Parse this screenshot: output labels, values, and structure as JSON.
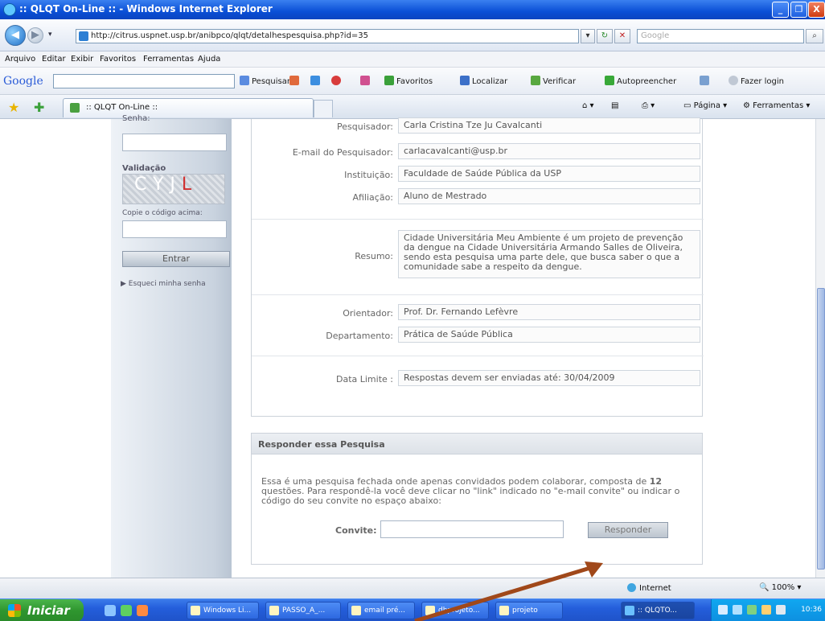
{
  "window": {
    "title": ":: QLQT On-Line :: - Windows Internet Explorer",
    "min_label": "_",
    "max_label": "❐",
    "close_label": "X"
  },
  "address": {
    "url": "http://citrus.uspnet.usp.br/anibpco/qlqt/detalhespesquisa.php?id=35",
    "go_label": "✕",
    "search_placeholder": "Google"
  },
  "menu": [
    "Arquivo",
    "Editar",
    "Exibir",
    "Favoritos",
    "Ferramentas",
    "Ajuda"
  ],
  "google_toolbar": {
    "logo": "Google",
    "items": [
      "Pesquisar",
      "Favoritos",
      "Localizar",
      "Verificar",
      "Autopreencher",
      "Fazer login"
    ]
  },
  "tabs": {
    "active_tab": ":: QLQT On-Line ::",
    "commands": [
      "Página",
      "Ferramentas"
    ]
  },
  "sidebar": {
    "senha_label": "Senha:",
    "validacao_label": "Validação",
    "captcha_text": "CYJL",
    "copy_code_label": "Copie o código acima:",
    "entrar_label": "Entrar",
    "forgot_label": "Esqueci minha senha"
  },
  "details": [
    {
      "key": "Pesquisador:",
      "value": "Carla Cristina Tze Ju Cavalcanti"
    },
    {
      "key": "E-mail do Pesquisador:",
      "value": "carlacavalcanti@usp.br"
    },
    {
      "key": "Instituição:",
      "value": "Faculdade de Saúde Pública da USP"
    },
    {
      "key": "Afiliação:",
      "value": "Aluno de Mestrado"
    },
    {
      "key": "Resumo:",
      "value": "Cidade Universitária Meu Ambiente é um projeto de prevenção da dengue na Cidade Universitária Armando Salles de Oliveira, sendo esta pesquisa uma parte dele, que busca saber o que a comunidade sabe a respeito da dengue."
    },
    {
      "key": "Orientador:",
      "value": "Prof. Dr. Fernando Lefèvre"
    },
    {
      "key": "Departamento:",
      "value": "Prática de Saúde Pública"
    },
    {
      "key": "Data Limite :",
      "value": "Respostas devem ser enviadas até: 30/04/2009"
    }
  ],
  "respond": {
    "title": "Responder essa Pesquisa",
    "text_1": "Essa é uma pesquisa fechada onde apenas convidados podem colaborar, composta de",
    "count": "12",
    "text_2": "questões. Para respondê-la você deve clicar no \"link\" indicado no \"e-mail convite\" ou indicar o código do seu convite no espaço abaixo:",
    "convite_label": "Convite:",
    "button_label": "Responder"
  },
  "status": {
    "zone": "Internet",
    "zoom": "100%"
  },
  "taskbar": {
    "start_label": "Iniciar",
    "tasks": [
      "Windows Li...",
      "PASSO_A_...",
      "email pré...",
      "dbprojeto...",
      "projeto",
      ":: QLQTO..."
    ],
    "clock": "10:36"
  },
  "colors": {
    "annotation_arrow": "#a0481a"
  }
}
